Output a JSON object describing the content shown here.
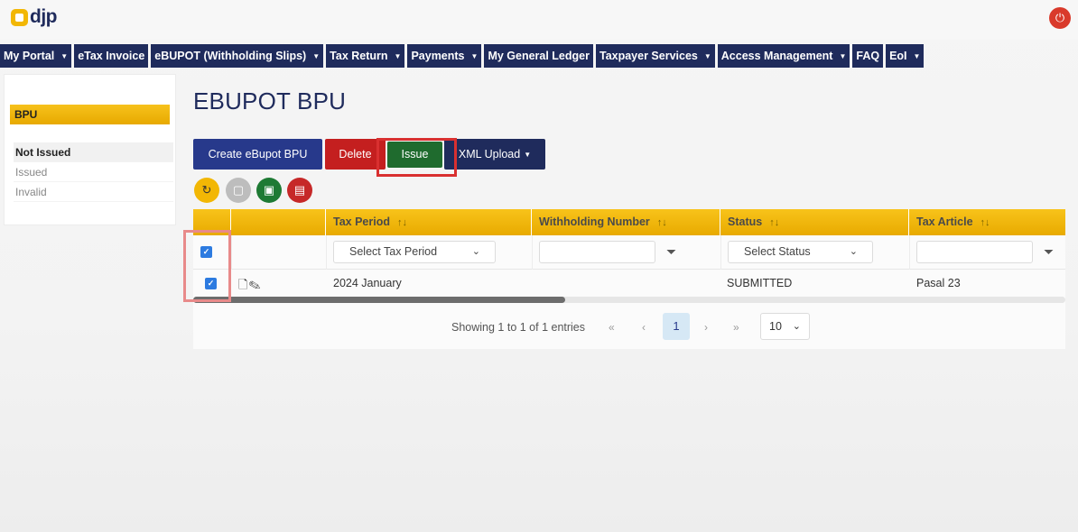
{
  "app": {
    "logo_text": "djp"
  },
  "nav": [
    {
      "label": "My Portal",
      "dropdown": true
    },
    {
      "label": "eTax Invoice",
      "dropdown": false
    },
    {
      "label": "eBUPOT (Withholding Slips)",
      "dropdown": true
    },
    {
      "label": "Tax Return",
      "dropdown": true
    },
    {
      "label": "Payments",
      "dropdown": true
    },
    {
      "label": "My General Ledger",
      "dropdown": false
    },
    {
      "label": "Taxpayer Services",
      "dropdown": true
    },
    {
      "label": "Access Management",
      "dropdown": true
    },
    {
      "label": "FAQ",
      "dropdown": false
    },
    {
      "label": "EoI",
      "dropdown": true
    }
  ],
  "sidebar": {
    "heading": "BPU",
    "items": [
      {
        "label": "Not Issued",
        "active": true
      },
      {
        "label": "Issued",
        "active": false
      },
      {
        "label": "Invalid",
        "active": false
      }
    ]
  },
  "page": {
    "title": "EBUPOT BPU"
  },
  "actions": {
    "create": "Create eBupot BPU",
    "delete": "Delete",
    "issue": "Issue",
    "xml_upload": "XML Upload"
  },
  "table": {
    "columns": [
      {
        "label": "Tax Period"
      },
      {
        "label": "Withholding Number"
      },
      {
        "label": "Status"
      },
      {
        "label": "Tax Article"
      }
    ],
    "filters": {
      "tax_period_placeholder": "Select Tax Period",
      "status_placeholder": "Select Status"
    },
    "rows": [
      {
        "tax_period": "2024 January",
        "withholding_number": "",
        "status": "SUBMITTED",
        "tax_article": "Pasal 23",
        "checked": true
      }
    ]
  },
  "pagination": {
    "info": "Showing 1 to 1 of 1 entries",
    "first": "«",
    "prev": "‹",
    "current": "1",
    "next": "›",
    "last": "»",
    "page_size": "10"
  },
  "colors": {
    "navy": "#1f2b5c",
    "gold": "#f2b705",
    "red": "#c41f1f",
    "green": "#1f6b2e",
    "blue": "#27398b"
  }
}
